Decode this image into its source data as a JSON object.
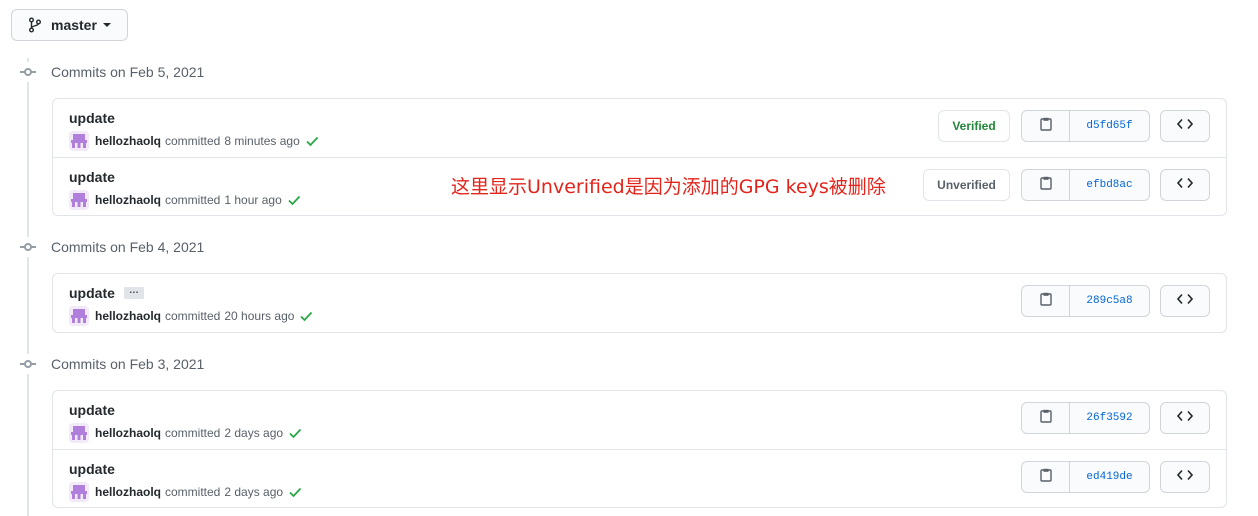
{
  "branch": {
    "label": "master"
  },
  "annotation": "这里显示Unverified是因为添加的GPG keys被删除",
  "groups": [
    {
      "title": "Commits on Feb 5, 2021",
      "commits": [
        {
          "message": "update",
          "author": "hellozhaolq",
          "committed": "committed",
          "time": "8 minutes ago",
          "badge": "Verified",
          "sha": "d5fd65f"
        },
        {
          "message": "update",
          "author": "hellozhaolq",
          "committed": "committed",
          "time": "1 hour ago",
          "badge": "Unverified",
          "sha": "efbd8ac"
        }
      ]
    },
    {
      "title": "Commits on Feb 4, 2021",
      "commits": [
        {
          "message": "update",
          "ellipsis": "…",
          "author": "hellozhaolq",
          "committed": "committed",
          "time": "20 hours ago",
          "sha": "289c5a8"
        }
      ]
    },
    {
      "title": "Commits on Feb 3, 2021",
      "commits": [
        {
          "message": "update",
          "author": "hellozhaolq",
          "committed": "committed",
          "time": "2 days ago",
          "sha": "26f3592"
        },
        {
          "message": "update",
          "author": "hellozhaolq",
          "committed": "committed",
          "time": "2 days ago",
          "sha": "ed419de"
        }
      ]
    }
  ],
  "colors": {
    "verified": "#22863a",
    "sha_link": "#0366d6",
    "annotation": "#e3241b",
    "check": "#28a745"
  }
}
